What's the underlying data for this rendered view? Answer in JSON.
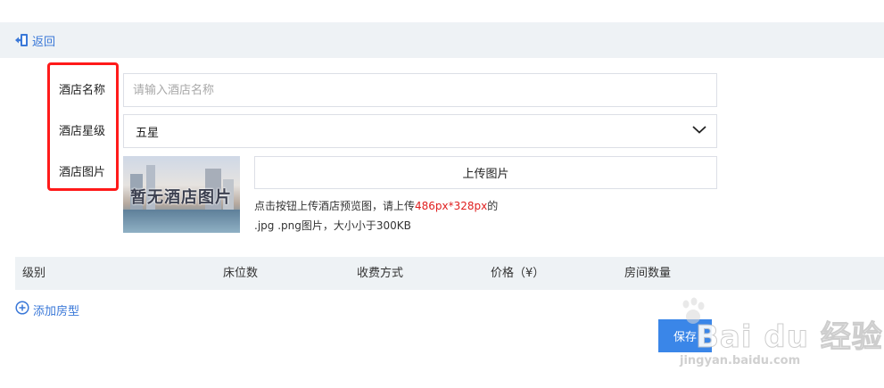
{
  "header": {
    "back_label": "返回"
  },
  "form": {
    "name_label": "酒店名称",
    "name_placeholder": "请输入酒店名称",
    "name_value": "",
    "star_label": "酒店星级",
    "star_value": "五星",
    "image_label": "酒店图片",
    "image_placeholder_text": "暂无酒店图片",
    "upload_label": "上传图片",
    "hint_prefix": "点击按钮上传酒店预览图，请上传",
    "hint_size": "486px*328px",
    "hint_suffix": "的",
    "hint_line2": ".jpg .png图片，大小小于300KB"
  },
  "table": {
    "columns": [
      "级别",
      "床位数",
      "收费方式",
      "价格（¥）",
      "房间数量"
    ]
  },
  "add_room_label": "添加房型",
  "save_label": "保存",
  "watermark": {
    "brand": "Bai du 经验",
    "url": "jingyan.baidu.com"
  },
  "colors": {
    "accent": "#3a78d8",
    "highlight_box": "#ff1a1a",
    "hint_red": "#e02020",
    "header_bg": "#eef2f5"
  }
}
